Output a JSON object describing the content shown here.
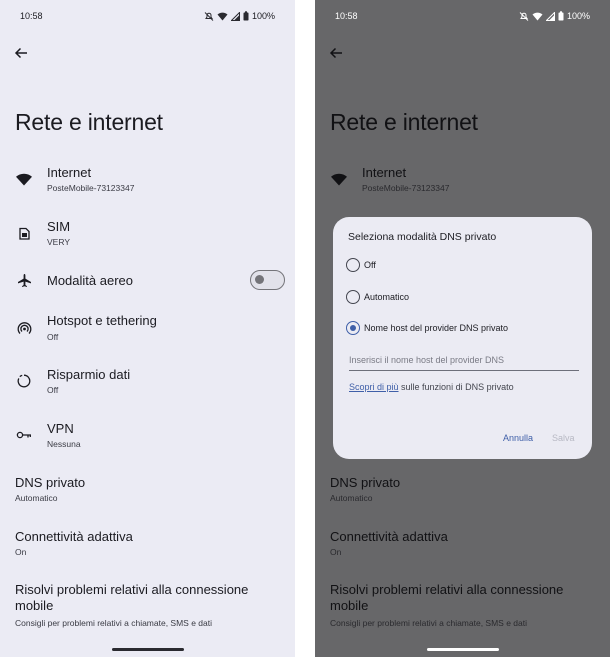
{
  "colors": {
    "light_bg": "#ebebf4",
    "dim_bg": "#676769",
    "accent": "#3f5fa8"
  },
  "status_bar": {
    "time": "10:58",
    "battery": "100%"
  },
  "page_title": "Rete e internet",
  "rows": [
    {
      "title": "Internet",
      "subtitle": "PosteMobile-73123347",
      "icon": "wifi-icon"
    },
    {
      "title": "SIM",
      "subtitle": "VERY",
      "icon": "sim-card-icon"
    },
    {
      "title": "Modalità aereo",
      "subtitle": "",
      "icon": "airplane-icon",
      "toggle_on": false
    },
    {
      "title": "Hotspot e tethering",
      "subtitle": "Off",
      "icon": "hotspot-icon"
    },
    {
      "title": "Risparmio dati",
      "subtitle": "Off",
      "icon": "data-saver-icon"
    },
    {
      "title": "VPN",
      "subtitle": "Nessuna",
      "icon": "vpn-key-icon"
    },
    {
      "title": "DNS privato",
      "subtitle": "Automatico"
    },
    {
      "title": "Connettività adattiva",
      "subtitle": "On"
    },
    {
      "title": "Risolvi problemi relativi alla connessione mobile",
      "subtitle": "Consigli per problemi relativi a chiamate, SMS e dati"
    }
  ],
  "dialog": {
    "title": "Seleziona modalità DNS privato",
    "options": [
      "Off",
      "Automatico",
      "Nome host del provider DNS privato"
    ],
    "selected_option": "Nome host del provider DNS privato",
    "input_placeholder": "Inserisci il nome host del provider DNS",
    "input_value": "",
    "learn_more_link": "Scopri di più",
    "learn_more_text": " sulle funzioni di DNS privato",
    "cancel_label": "Annulla",
    "save_label": "Salva"
  }
}
